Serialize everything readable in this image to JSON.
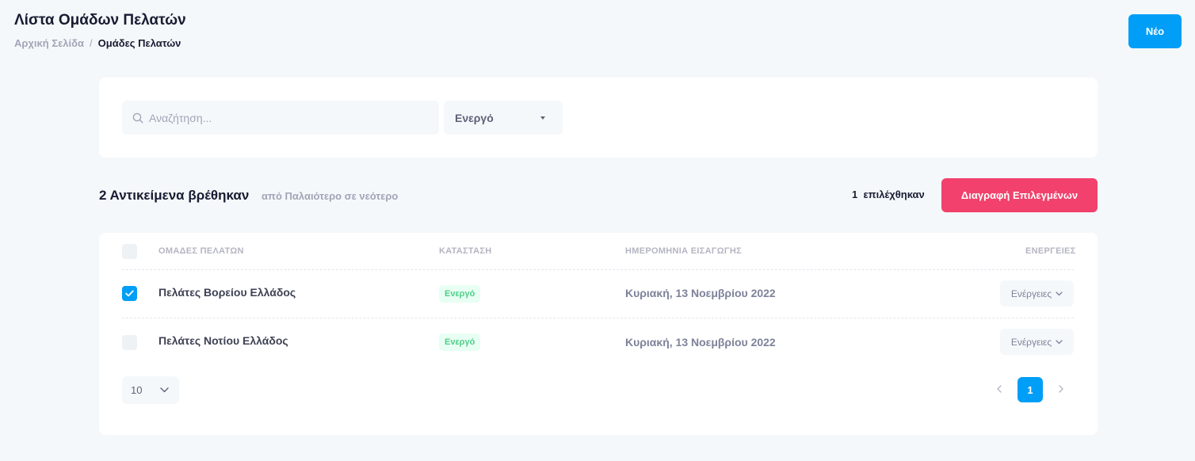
{
  "header": {
    "title": "Λίστα Ομάδων Πελατών",
    "breadcrumb": {
      "home": "Αρχική Σελίδα",
      "separator": "/",
      "current": "Ομάδες Πελατών"
    },
    "new_button": "Νέο"
  },
  "filters": {
    "search_placeholder": "Αναζήτηση...",
    "status_selected": "Ενεργό"
  },
  "results": {
    "count_text": "2 Αντικείμενα βρέθηκαν",
    "sort_text": "από Παλαιότερο σε νεότερο",
    "selected_text": "1  επιλέχθηκαν",
    "delete_button": "Διαγραφή Επιλεγμένων"
  },
  "table": {
    "columns": [
      "ΟΜΑΔΕΣ ΠΕΛΑΤΩΝ",
      "ΚΑΤΑΣΤΑΣΗ",
      "ΗΜΕΡΟΜΗΝΙΑ ΕΙΣΑΓΩΓΗΣ",
      "ΕΝΕΡΓΕΙΕΣ"
    ],
    "rows": [
      {
        "selected": true,
        "name": "Πελάτες Βορείου Ελλάδος",
        "status": "Ενεργό",
        "date": "Κυριακή, 13 Νοεμβρίου 2022",
        "actions": "Ενέργειες"
      },
      {
        "selected": false,
        "name": "Πελάτες Νοτίου Ελλάδος",
        "status": "Ενεργό",
        "date": "Κυριακή, 13 Νοεμβρίου 2022",
        "actions": "Ενέργειες"
      }
    ]
  },
  "pagination": {
    "page_size": "10",
    "current_page": "1"
  },
  "colors": {
    "primary": "#009ef7",
    "danger": "#f1416c",
    "success": "#50cd89",
    "success_light": "#e8fff3",
    "background": "#f5f8fa"
  }
}
